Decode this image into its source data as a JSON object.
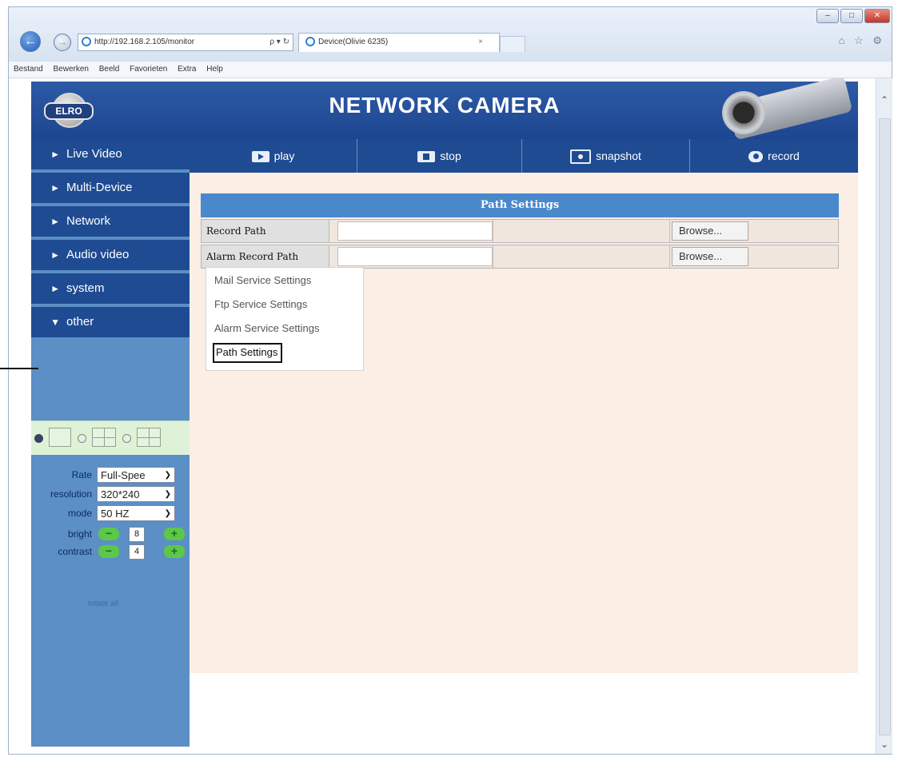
{
  "browser": {
    "window_controls": [
      "–",
      "□",
      "✕"
    ],
    "address": "http://192.168.2.105/monitor",
    "address_controls": "ρ ▾ ↻",
    "tab_title": "Device(Olivie 6235)",
    "tab_close": "×",
    "toolbar_icons": "⌂ ☆ ⚙",
    "menu": [
      "Bestand",
      "Bewerken",
      "Beeld",
      "Favorieten",
      "Extra",
      "Help"
    ]
  },
  "header": {
    "logo_text": "ELRO",
    "title": "NETWORK CAMERA"
  },
  "sidebar": {
    "items": [
      {
        "arrow": "►",
        "label": "Live Video"
      },
      {
        "arrow": "►",
        "label": "Multi-Device"
      },
      {
        "arrow": "►",
        "label": "Network"
      },
      {
        "arrow": "►",
        "label": "Audio video"
      },
      {
        "arrow": "►",
        "label": "system"
      },
      {
        "arrow": "▼",
        "label": "other"
      }
    ],
    "controls": {
      "rate_label": "Rate",
      "rate_value": "Full-Spee",
      "resolution_label": "resolution",
      "resolution_value": "320*240",
      "mode_label": "mode",
      "mode_value": "50 HZ",
      "bright_label": "bright",
      "bright_value": "8",
      "contrast_label": "contrast",
      "contrast_value": "4",
      "minus": "−",
      "plus": "+"
    },
    "rotate_link": "rotate all"
  },
  "toolbar": {
    "play": "play",
    "stop": "stop",
    "snapshot": "snapshot",
    "record": "record"
  },
  "path_settings": {
    "title": "Path Settings",
    "rows": [
      {
        "label": "Record Path",
        "value": "",
        "button": "Browse..."
      },
      {
        "label": "Alarm Record Path",
        "value": "",
        "button": "Browse..."
      }
    ]
  },
  "other_menu": {
    "items": [
      "Mail Service Settings",
      "Ftp Service Settings",
      "Alarm Service Settings",
      "Path Settings"
    ],
    "selected": "Path Settings"
  }
}
